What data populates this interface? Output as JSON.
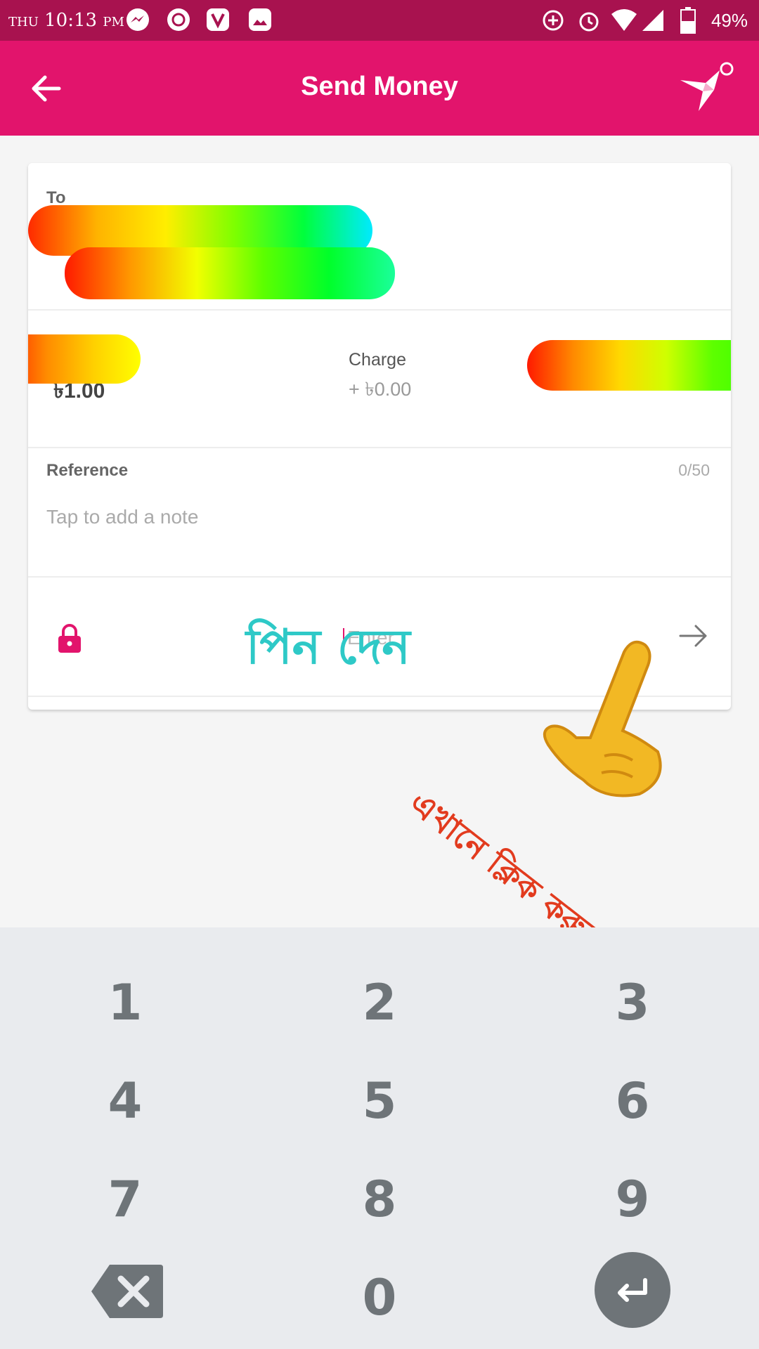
{
  "status_bar": {
    "day": "THU",
    "time": "10:13",
    "ampm": "PM",
    "battery": "49%"
  },
  "app_bar": {
    "title": "Send Money"
  },
  "recipient": {
    "label": "To"
  },
  "amount": {
    "value": "৳1.00"
  },
  "charge": {
    "label": "Charge",
    "value": "+ ৳0.00"
  },
  "reference": {
    "label": "Reference",
    "counter": "0/50",
    "placeholder": "Tap to add a note"
  },
  "pin": {
    "placeholder": "Enter"
  },
  "annotations": {
    "pin_hint": "পিন দেন",
    "click_hint": "এখানে ক্লিক করুন"
  },
  "keypad": {
    "keys": [
      "1",
      "2",
      "3",
      "4",
      "5",
      "6",
      "7",
      "8",
      "9",
      "0"
    ]
  },
  "colors": {
    "brand": "#e2146c",
    "status_bar": "#a8124f",
    "keypad_bg": "#e9ebee",
    "key_text": "#6e7478"
  }
}
